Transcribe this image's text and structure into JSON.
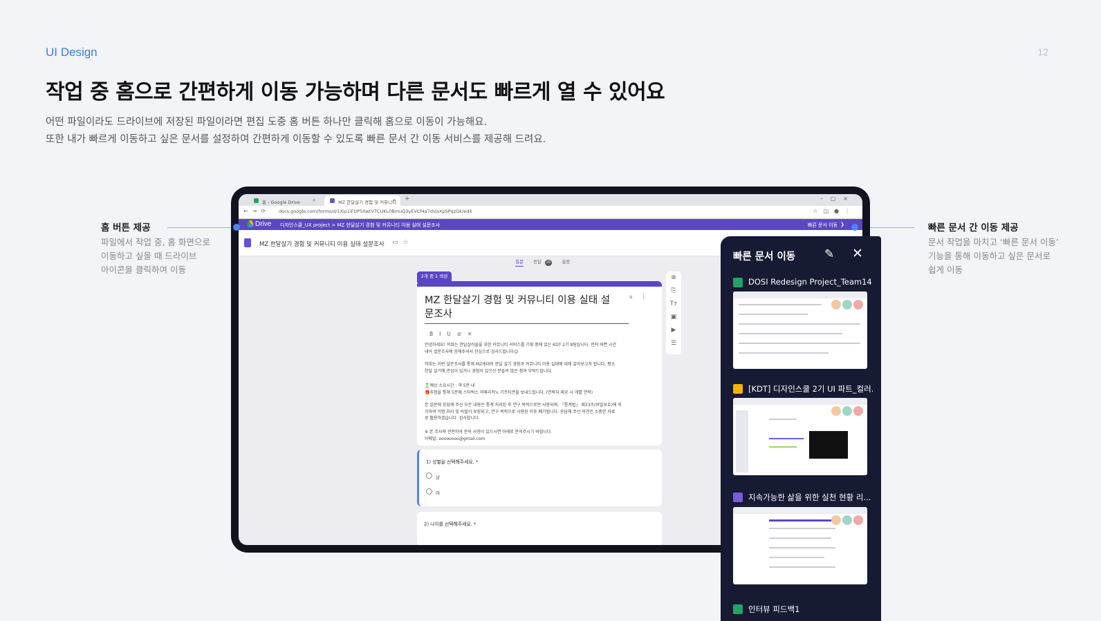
{
  "header": {
    "kicker": "UI Design",
    "page_number": "12",
    "title": "작업 중 홈으로 간편하게 이동 가능하며 다른 문서도 빠르게 열 수 있어요",
    "desc_line1": "어떤 파일이라도 드라이브에 저장된 파일이라면 편집 도중 홈 버튼 하나만 클릭해 홈으로 이동이 가능해요.",
    "desc_line2": "또한 내가 빠르게 이동하고 싶은 문서를 설정하여 간편하게 이동할 수 있도록 빠른 문서 간 이동 서비스를 제공해 드려요."
  },
  "callouts": {
    "left": {
      "title": "홈 버튼 제공",
      "line1": "파일에서 작업 중, 홈 화면으로",
      "line2": "이동하고 싶을 때 드라이브",
      "line3": "아이콘을 클릭하여 이동"
    },
    "right": {
      "title": "빠른 문서 간 이동 제공",
      "line1": "문서 작업을 마치고 ‘빠른 문서 이동’",
      "line2": "기능을 통해 이동하고 싶은 문서로",
      "line3": "쉽게 이동"
    }
  },
  "browser": {
    "tab1_label": "홈 - Google Drive",
    "tab2_label": "MZ 한달살기 경험 및 커뮤니티",
    "url": "docs.google.com/forms/d/1Xip1iFUP50wtV7CUKL0BmuQ3yEVCf4a7dvjsXpSPqzGk/edit",
    "drive_label": "Drive",
    "breadcrumb": "디자인스쿨_UX project   >   MZ 한달살기 경험 및 커뮤니티 이용 실태 설문조사",
    "quick_move_label": "빠른 문서 이동"
  },
  "form": {
    "doc_title": "MZ 한달살기 경험 및 커뮤니티 이용 실태 설문조사",
    "tabs": {
      "questions": "질문",
      "responses": "응답",
      "response_count": "20",
      "settings": "설정"
    },
    "section_label": "2개 중 1 섹션",
    "title_line1": "MZ 한달살기 경험 및 커뮤니티 이용 실태 설",
    "title_line2": "문조사",
    "para1a": "안녕하세요! 저희는 한달살러들을 위한 커뮤니티 서비스를 기획 중에 있는 KDT 2기 8팀입니다. 먼저 바쁜 시간",
    "para1b": "내어 설문조사에 응해주셔서 진심으로 감사드립니다😊",
    "para2a": "저희는 이번 설문조사를 통해 MZ세대의 한달 살기 경험과 커뮤니티 이용 실태에 대해 알아보고자 합니다. 평소",
    "para2b": "한달 살기에 관심이 있거나 경험이 있으신 분들의 많은 참여 부탁드립니다.",
    "time_line": "⏳예상 소요시간 : 약 5분 내",
    "gift_line": "🎁추첨을 통해 5분께 스타벅스 아메리카노 기프티콘을 보내드립니다. (연락처 제공 시 개별 연락)",
    "para3a": "본 설문에 응답해 주신 모든 내용은 통계 처리된 후 연구 목적으로만 사용되며, 「통계법」 제33조(비밀보호)에 의",
    "para3b": "거하여 익명 처리 및 비밀이 보장되고, 연구 목적으로 사용된 이후 폐기됩니다. 응답해 주신 의견은 소중한 자료",
    "para3c": "로 활용하겠습니다. 감사합니다.",
    "contact_line": "※ 본 조사와 관련하여 문의 사항이 있으시면 아래로 문의주시기 바랍니다.",
    "email_line": "이메일: oooooooo@gmail.com",
    "q1": "1) 성별을 선택해주세요. *",
    "q1_opt1": "남",
    "q1_opt2": "여",
    "q2": "2) 나이를 선택해주세요. *"
  },
  "quick_panel": {
    "title": "빠른 문서 이동",
    "items": [
      {
        "label": "DOSI Redesign Project_Team14",
        "icon": "sheets-icon",
        "color": "#21a464"
      },
      {
        "label": "[KDT] 디자인스쿨 2기 UI 파트_컬러...",
        "icon": "slides-icon",
        "color": "#f4b400"
      },
      {
        "label": "지속가능한 삶을 위한 실천 현황 리...",
        "icon": "forms-icon",
        "color": "#7b5bd6"
      },
      {
        "label": "인터뷰 피드백1",
        "icon": "sheets-icon",
        "color": "#21a464"
      }
    ]
  },
  "colors": {
    "accent_blue": "#3d7be8",
    "drive_bar": "#5b47c4",
    "panel_bg": "#161a33"
  }
}
